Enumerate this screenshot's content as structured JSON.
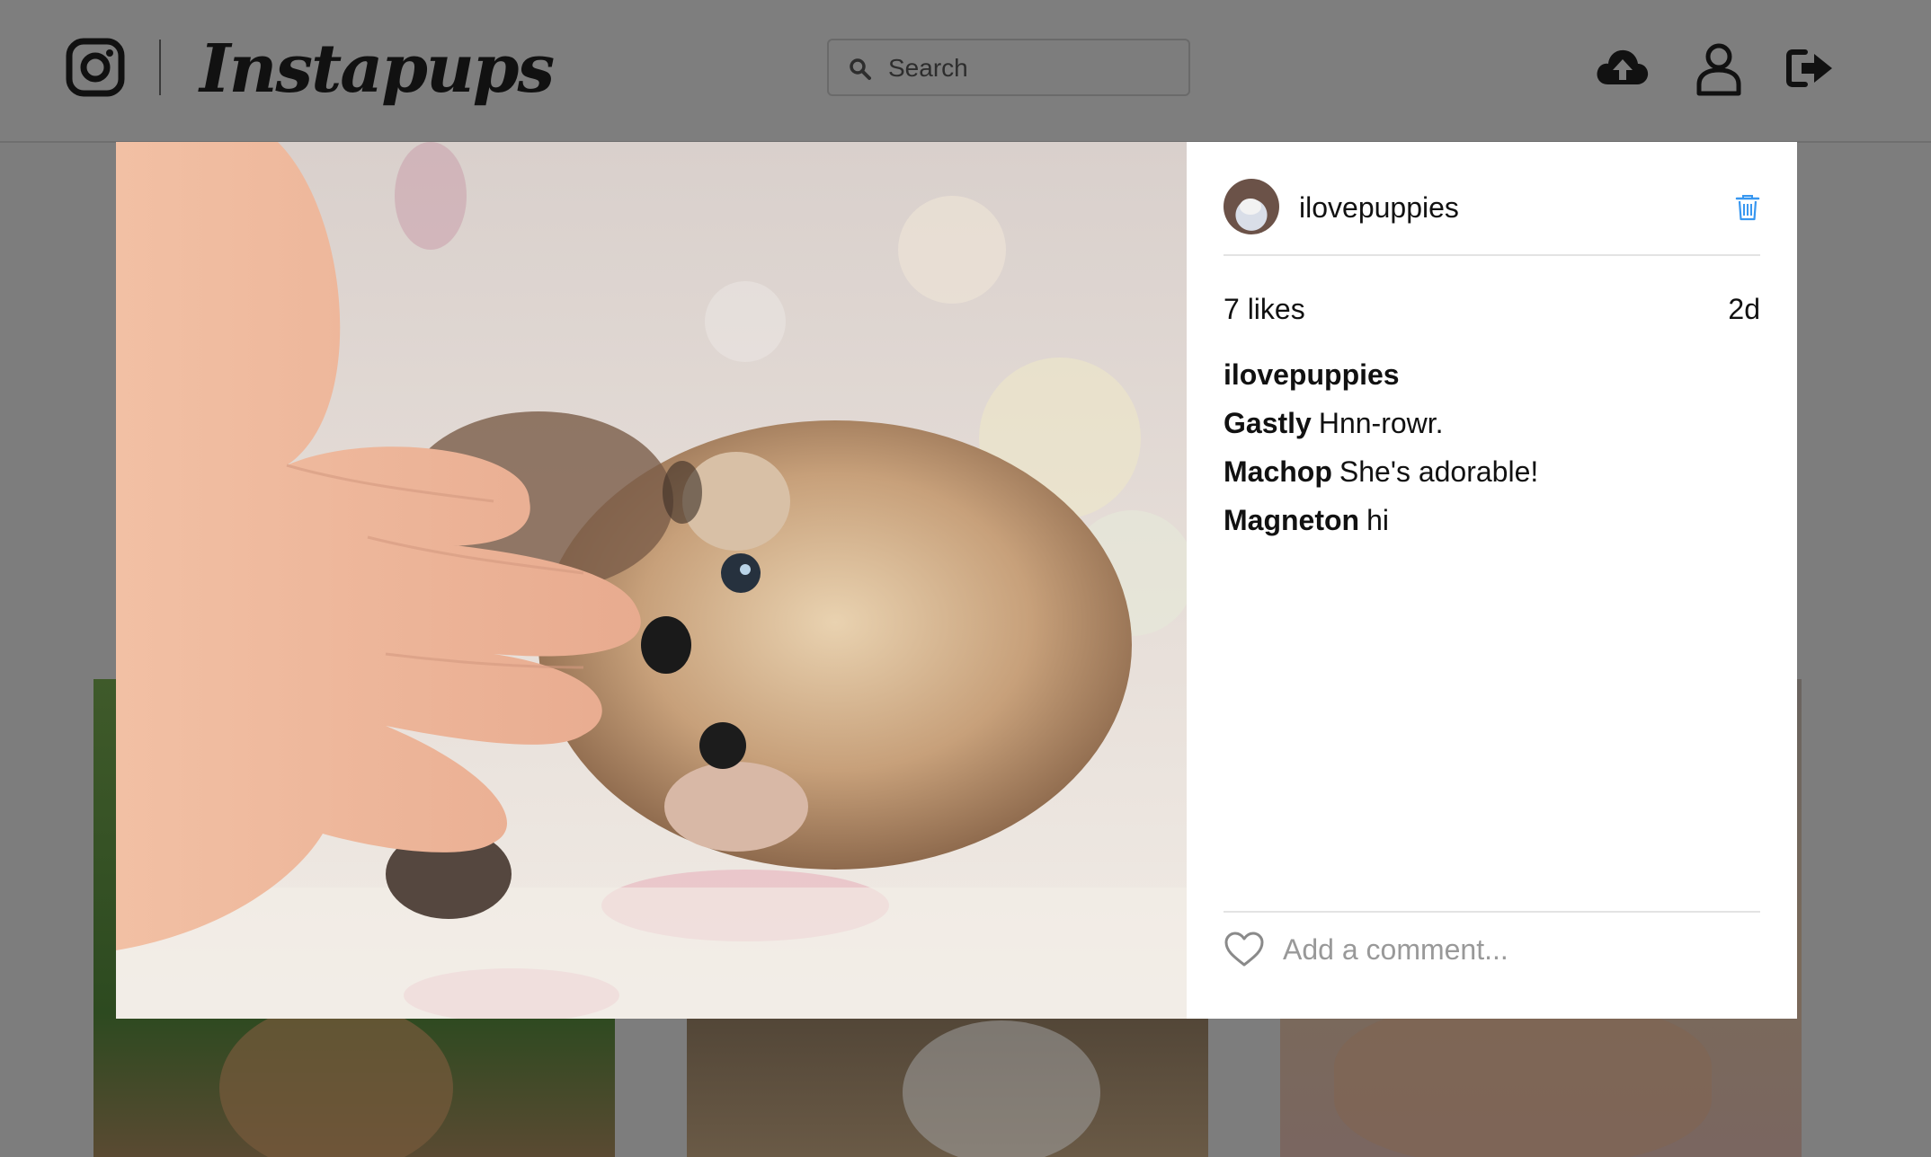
{
  "header": {
    "brand": "Instapups",
    "search_placeholder": "Search"
  },
  "post": {
    "username": "ilovepuppies",
    "likes": "7 likes",
    "age": "2d",
    "caption_user": "ilovepuppies",
    "comments": [
      {
        "user": "Gastly",
        "text": "Hnn-rowr."
      },
      {
        "user": "Machop",
        "text": "She's adorable!"
      },
      {
        "user": "Magneton",
        "text": "hi"
      }
    ],
    "comment_placeholder": "Add a comment..."
  },
  "colors": {
    "overlay_bg": "#7d7d7d",
    "accent_blue": "#3897f0",
    "divider": "#e3e3e3"
  },
  "icons": [
    "instagram-camera-icon",
    "search-icon",
    "cloud-upload-icon",
    "user-icon",
    "sign-out-icon",
    "trash-icon",
    "heart-icon"
  ]
}
